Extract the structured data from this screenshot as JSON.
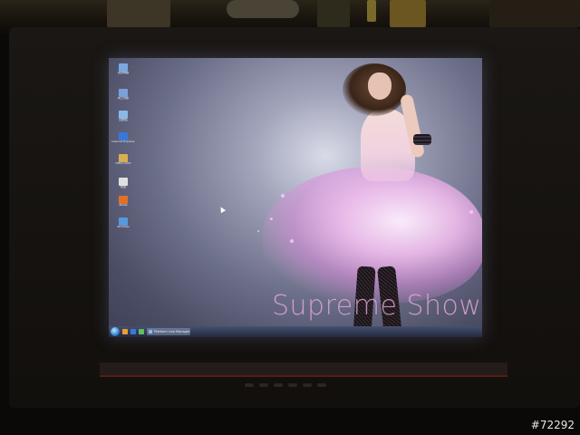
{
  "photo": {
    "watermark": "#72292"
  },
  "desktop": {
    "wallpaper_text": "Supreme Show",
    "icons": [
      {
        "label": "我的电脑",
        "glyph_color": "#7aa8e0",
        "icon": "computer-icon"
      },
      {
        "label": "网上邻居",
        "glyph_color": "#7aa0d8",
        "icon": "network-icon"
      },
      {
        "label": "回收站",
        "glyph_color": "#8cb8e8",
        "icon": "recycle-bin-icon"
      },
      {
        "label": "Internet Explorer",
        "glyph_color": "#3a78d8",
        "icon": "ie-icon"
      },
      {
        "label": "Office 2007",
        "glyph_color": "#d8b050",
        "icon": "office-icon"
      },
      {
        "label": "新建",
        "glyph_color": "#e0e0e0",
        "icon": "document-icon"
      },
      {
        "label": "Media",
        "glyph_color": "#e07028",
        "icon": "media-icon"
      },
      {
        "label": "Windows",
        "glyph_color": "#5898e0",
        "icon": "windows-icon"
      }
    ]
  },
  "taskbar": {
    "task_label": "Platform Live Manager",
    "quick_launch_colors": [
      "#e8a030",
      "#3a78d8",
      "#5fbf60"
    ]
  }
}
